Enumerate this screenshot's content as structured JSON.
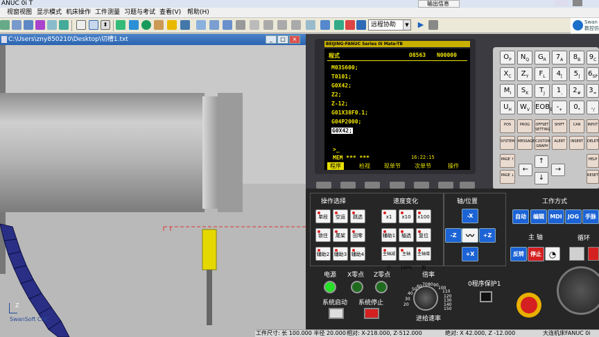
{
  "window": {
    "title": "ANUC 0i T"
  },
  "menu": [
    "视窗视图",
    "显示模式",
    "机床操作",
    "工件测量",
    "习题与考试",
    "查看(V)",
    "帮助(H)"
  ],
  "toolbar": {
    "remote_select": "远程协助"
  },
  "sim": {
    "title": "C:\\Users\\zny850210\\Desktop\\切槽1.txt",
    "axis_label": "Z",
    "watermark": "SwanSoft CNC",
    "minimize": "_",
    "restore": "□",
    "close": "×"
  },
  "top_right": {
    "label": "输出信息"
  },
  "brand": {
    "line1": "Swan",
    "line2": "数控仿"
  },
  "fanuc": {
    "header": "BEIJING-FANUC Series 0i Mate-TB",
    "mode": "程式",
    "prog_no": "O8563",
    "seq_no": "N00000",
    "program": [
      "M03S600;",
      "T0101;",
      "G0X42;",
      "Z2;",
      "Z-12;",
      "G01X38F0.1;",
      "G04P2000;",
      "G0X42;"
    ],
    "prompt": ">_",
    "status": "MEM *** ***",
    "time": "16:22:15",
    "softkeys": [
      "程序",
      "检视",
      "现单节",
      "次单节",
      "操作"
    ]
  },
  "keypad": {
    "address_keys": [
      [
        "O",
        "P"
      ],
      [
        "N",
        "Q"
      ],
      [
        "G",
        "R"
      ],
      [
        "7",
        "A"
      ],
      [
        "8",
        "B"
      ],
      [
        "9",
        "C"
      ],
      [
        "X",
        "C"
      ],
      [
        "Z",
        "Y"
      ],
      [
        "F",
        "L"
      ],
      [
        "4",
        "["
      ],
      [
        "5",
        "]"
      ],
      [
        "6",
        "SP"
      ],
      [
        "M",
        "I"
      ],
      [
        "S",
        "K"
      ],
      [
        "T",
        "J"
      ],
      [
        "1",
        ","
      ],
      [
        "2",
        "#"
      ],
      [
        "3",
        "="
      ],
      [
        "U",
        "H"
      ],
      [
        "W",
        "V"
      ],
      [
        "EOB",
        "E"
      ],
      [
        "-",
        "+"
      ],
      [
        "0",
        "*"
      ],
      [
        ".",
        "/"
      ]
    ],
    "func_keys": [
      "POS",
      "PROG",
      "OFFSET SETTING",
      "SHIFT",
      "CAN",
      "INPUT",
      "SYSTEM",
      "MESSAGE",
      "CUSTOM GRAPH",
      "ALERT",
      "INSERT",
      "DELETE"
    ],
    "page_up": "PAGE ↑",
    "page_down": "PAGE ↓",
    "help": "HELP",
    "reset": "RESET"
  },
  "panel": {
    "op_select": "操作选择",
    "op_buttons": [
      "单段",
      "空运行",
      "跳选",
      "锁住",
      "尾架",
      "回零",
      "辅助2",
      "辅助3",
      "辅助4"
    ],
    "speed": "速度变化",
    "speed_buttons": [
      "x1",
      "x10",
      "x100",
      "辅助1",
      "轴选择",
      "复位",
      "主轴减少",
      "主轴100%",
      "主轴增加"
    ],
    "axis": "轴/位置",
    "axis_buttons": [
      "-X",
      "-Z",
      "+Z",
      "+X"
    ],
    "mode": "工作方式",
    "mode_buttons": [
      "自动",
      "编辑",
      "MDI",
      "JOG",
      "手脉"
    ],
    "spindle": "主 轴",
    "spindle_buttons": [
      "反转",
      "停止"
    ],
    "cycle": "循环",
    "power": "电源",
    "x_zero": "X零点",
    "z_zero": "Z零点",
    "sys_start": "系统启动",
    "sys_stop": "系统停止",
    "rate": "倍率",
    "feed_rate": "进给速率",
    "rate_ticks": [
      "20",
      "30",
      "40",
      "50",
      "60",
      "70",
      "80",
      "90",
      "100",
      "110",
      "120",
      "130",
      "140",
      "150"
    ],
    "protect": "0程序保护1"
  },
  "statusbar": {
    "workpiece": "工件尺寸: 长 100.000 半径  20.000",
    "relative": "相对: X-218.000, Z-512.000",
    "absolute": "绝对: X  42.000, Z -12.000",
    "brand": "大连机床FANUC 0i"
  }
}
